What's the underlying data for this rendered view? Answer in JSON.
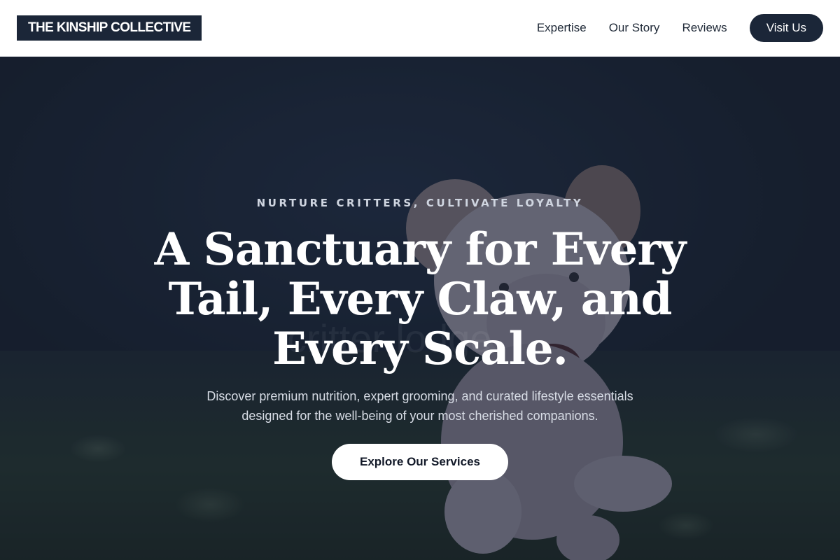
{
  "header": {
    "logo": "THE KINSHIP COLLECTIVE",
    "nav": [
      {
        "label": "Expertise"
      },
      {
        "label": "Our Story"
      },
      {
        "label": "Reviews"
      }
    ],
    "cta_label": "Visit Us"
  },
  "hero": {
    "eyebrow": "NURTURE CRITTERS, CULTIVATE LOYALTY",
    "headline": "A Sanctuary for Every Tail, Every Claw, and Every Scale.",
    "subtext": "Discover premium nutrition, expert grooming, and curated lifestyle essentials designed for the well-being of your most cherished companions.",
    "button_label": "Explore Our Services",
    "watermark": "critter lodge"
  },
  "colors": {
    "brand_dark": "#1b2638",
    "overlay": "#141c2d",
    "text_light": "#ffffff"
  }
}
